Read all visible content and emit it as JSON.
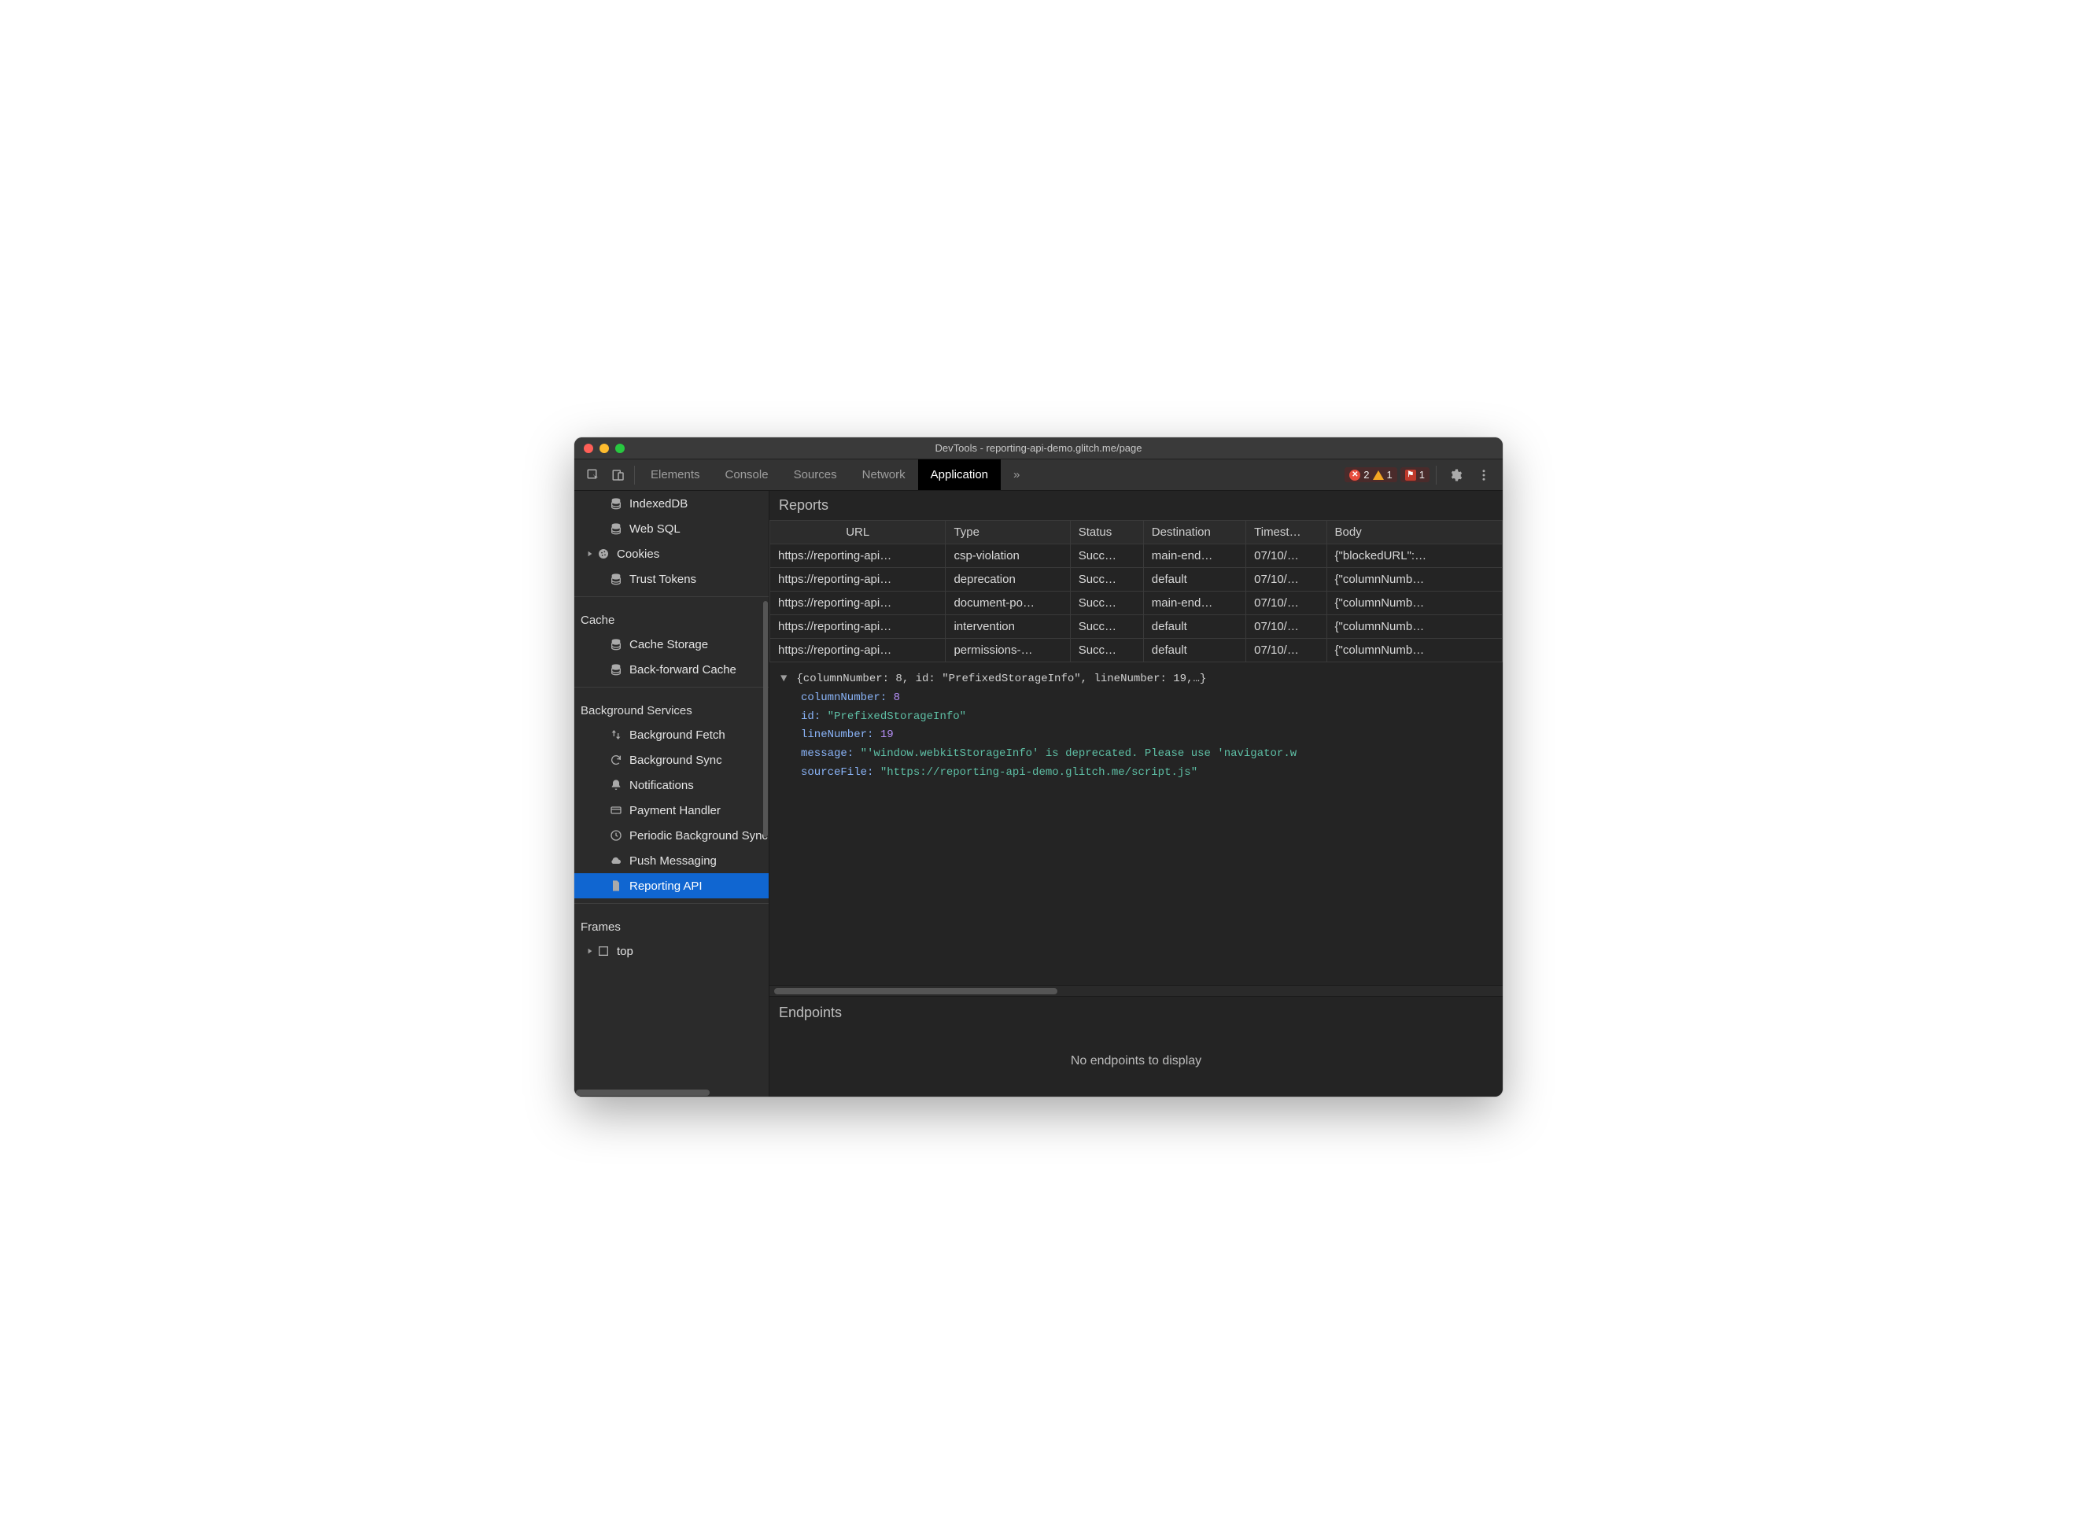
{
  "window": {
    "title": "DevTools - reporting-api-demo.glitch.me/page"
  },
  "toolbar": {
    "tabs": [
      "Elements",
      "Console",
      "Sources",
      "Network",
      "Application"
    ],
    "active_tab_index": 4,
    "more_label": "»",
    "errors_count": "2",
    "warnings_count": "1",
    "issues_count": "1"
  },
  "sidebar": {
    "items_pre": [
      {
        "label": "IndexedDB",
        "icon": "database",
        "level": 1
      },
      {
        "label": "Web SQL",
        "icon": "database",
        "level": 1
      },
      {
        "label": "Cookies",
        "icon": "cookie",
        "level": 1,
        "expandable": true
      },
      {
        "label": "Trust Tokens",
        "icon": "database",
        "level": 1
      }
    ],
    "groups": [
      {
        "title": "Cache",
        "items": [
          {
            "label": "Cache Storage",
            "icon": "database"
          },
          {
            "label": "Back-forward Cache",
            "icon": "database"
          }
        ]
      },
      {
        "title": "Background Services",
        "items": [
          {
            "label": "Background Fetch",
            "icon": "updown"
          },
          {
            "label": "Background Sync",
            "icon": "sync"
          },
          {
            "label": "Notifications",
            "icon": "bell"
          },
          {
            "label": "Payment Handler",
            "icon": "card"
          },
          {
            "label": "Periodic Background Sync",
            "icon": "clock"
          },
          {
            "label": "Push Messaging",
            "icon": "cloud"
          },
          {
            "label": "Reporting API",
            "icon": "file",
            "selected": true
          }
        ]
      },
      {
        "title": "Frames",
        "items": [
          {
            "label": "top",
            "icon": "frame",
            "expandable": true
          }
        ]
      }
    ]
  },
  "reports": {
    "title": "Reports",
    "columns": [
      "URL",
      "Type",
      "Status",
      "Destination",
      "Timest…",
      "Body"
    ],
    "rows": [
      {
        "url": "https://reporting-api…",
        "type": "csp-violation",
        "status": "Succ…",
        "destination": "main-end…",
        "timestamp": "07/10/…",
        "body": "{\"blockedURL\":…"
      },
      {
        "url": "https://reporting-api…",
        "type": "deprecation",
        "status": "Succ…",
        "destination": "default",
        "timestamp": "07/10/…",
        "body": "{\"columnNumb…"
      },
      {
        "url": "https://reporting-api…",
        "type": "document-po…",
        "status": "Succ…",
        "destination": "main-end…",
        "timestamp": "07/10/…",
        "body": "{\"columnNumb…"
      },
      {
        "url": "https://reporting-api…",
        "type": "intervention",
        "status": "Succ…",
        "destination": "default",
        "timestamp": "07/10/…",
        "body": "{\"columnNumb…"
      },
      {
        "url": "https://reporting-api…",
        "type": "permissions-…",
        "status": "Succ…",
        "destination": "default",
        "timestamp": "07/10/…",
        "body": "{\"columnNumb…"
      }
    ]
  },
  "detail": {
    "summary": "{columnNumber: 8, id: \"PrefixedStorageInfo\", lineNumber: 19,…}",
    "columnNumber_k": "columnNumber:",
    "columnNumber_v": "8",
    "id_k": "id:",
    "id_v": "\"PrefixedStorageInfo\"",
    "lineNumber_k": "lineNumber:",
    "lineNumber_v": "19",
    "message_k": "message:",
    "message_v": "\"'window.webkitStorageInfo' is deprecated. Please use 'navigator.w",
    "sourceFile_k": "sourceFile:",
    "sourceFile_v": "\"https://reporting-api-demo.glitch.me/script.js\""
  },
  "endpoints": {
    "title": "Endpoints",
    "empty": "No endpoints to display"
  }
}
